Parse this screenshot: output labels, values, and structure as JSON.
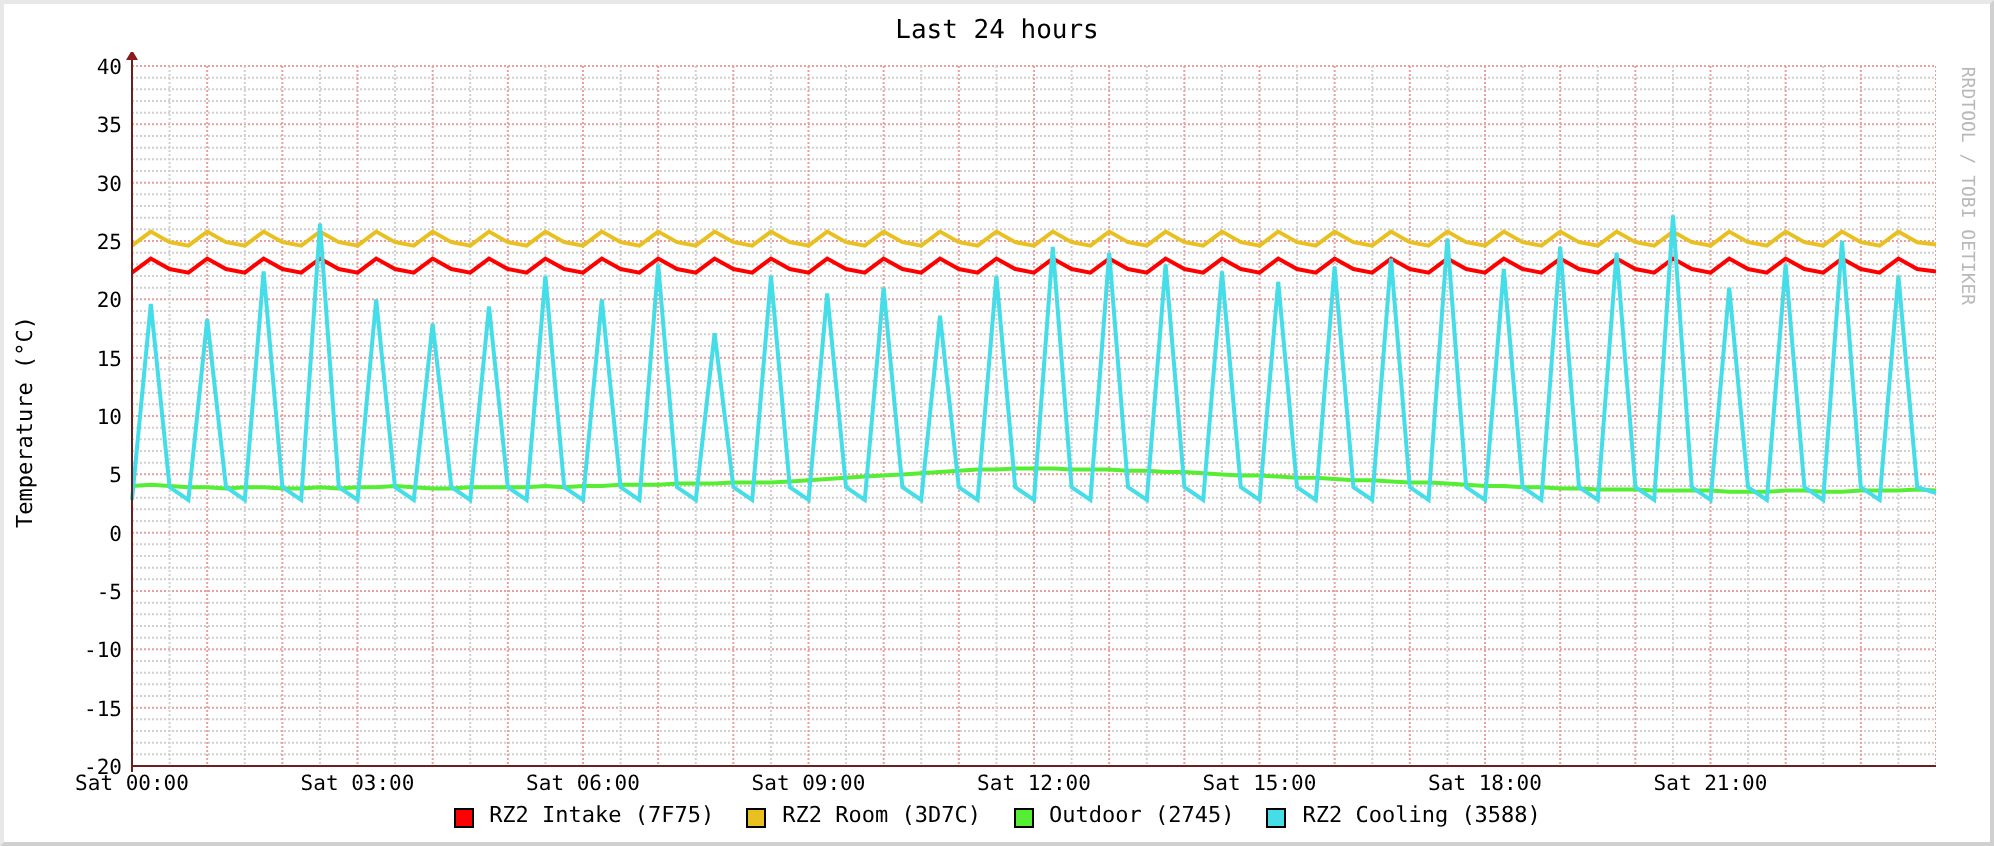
{
  "graph": {
    "side_label": "RRDTOOL / TOBI OETIKER",
    "chart_data": {
      "type": "line",
      "title": "Last 24 hours",
      "ylabel": "Temperature (°C)",
      "categories": [
        "Sat 00:00",
        null,
        null,
        null,
        null,
        null,
        null,
        null,
        null,
        null,
        null,
        null,
        "Sat 03:00",
        null,
        null,
        null,
        null,
        null,
        null,
        null,
        null,
        null,
        null,
        null,
        "Sat 06:00",
        null,
        null,
        null,
        null,
        null,
        null,
        null,
        null,
        null,
        null,
        null,
        "Sat 09:00",
        null,
        null,
        null,
        null,
        null,
        null,
        null,
        null,
        null,
        null,
        null,
        "Sat 12:00",
        null,
        null,
        null,
        null,
        null,
        null,
        null,
        null,
        null,
        null,
        null,
        "Sat 15:00",
        null,
        null,
        null,
        null,
        null,
        null,
        null,
        null,
        null,
        null,
        null,
        "Sat 18:00",
        null,
        null,
        null,
        null,
        null,
        null,
        null,
        null,
        null,
        null,
        null,
        "Sat 21:00",
        null,
        null,
        null,
        null,
        null,
        null,
        null,
        null,
        null,
        null,
        null,
        null
      ],
      "ylim": [
        -20,
        40
      ],
      "grid": true,
      "yticks": [
        -20,
        -15,
        -10,
        -5,
        0,
        5,
        10,
        15,
        20,
        25,
        30,
        35,
        40
      ],
      "series": [
        {
          "name": "RZ2 Intake (7F75)",
          "color": "#ff0000",
          "values": [
            22.3,
            23.5,
            22.6,
            22.3,
            23.5,
            22.6,
            22.3,
            23.5,
            22.6,
            22.3,
            23.5,
            22.6,
            22.3,
            23.5,
            22.6,
            22.3,
            23.5,
            22.6,
            22.3,
            23.5,
            22.6,
            22.3,
            23.5,
            22.6,
            22.3,
            23.5,
            22.6,
            22.3,
            23.5,
            22.6,
            22.3,
            23.5,
            22.6,
            22.3,
            23.5,
            22.6,
            22.3,
            23.5,
            22.6,
            22.3,
            23.5,
            22.6,
            22.3,
            23.5,
            22.6,
            22.3,
            23.5,
            22.6,
            22.3,
            23.5,
            22.6,
            22.3,
            23.5,
            22.6,
            22.3,
            23.5,
            22.6,
            22.3,
            23.5,
            22.6,
            22.3,
            23.5,
            22.6,
            22.3,
            23.5,
            22.6,
            22.3,
            23.5,
            22.6,
            22.3,
            23.5,
            22.6,
            22.3,
            23.5,
            22.6,
            22.3,
            23.5,
            22.6,
            22.3,
            23.5,
            22.6,
            22.3,
            23.5,
            22.6,
            22.3,
            23.5,
            22.6,
            22.3,
            23.5,
            22.6,
            22.3,
            23.5,
            22.6,
            22.3,
            23.5,
            22.6,
            22.4
          ]
        },
        {
          "name": "RZ2 Room (3D7C)",
          "color": "#e8c020",
          "values": [
            24.6,
            25.8,
            24.9,
            24.6,
            25.8,
            24.9,
            24.6,
            25.8,
            24.9,
            24.6,
            25.8,
            24.9,
            24.6,
            25.8,
            24.9,
            24.6,
            25.8,
            24.9,
            24.6,
            25.8,
            24.9,
            24.6,
            25.8,
            24.9,
            24.6,
            25.8,
            24.9,
            24.6,
            25.8,
            24.9,
            24.6,
            25.8,
            24.9,
            24.6,
            25.8,
            24.9,
            24.6,
            25.8,
            24.9,
            24.6,
            25.8,
            24.9,
            24.6,
            25.8,
            24.9,
            24.6,
            25.8,
            24.9,
            24.6,
            25.8,
            24.9,
            24.6,
            25.8,
            24.9,
            24.6,
            25.8,
            24.9,
            24.6,
            25.8,
            24.9,
            24.6,
            25.8,
            24.9,
            24.6,
            25.8,
            24.9,
            24.6,
            25.8,
            24.9,
            24.6,
            25.8,
            24.9,
            24.6,
            25.8,
            24.9,
            24.6,
            25.8,
            24.9,
            24.6,
            25.8,
            24.9,
            24.6,
            25.8,
            24.9,
            24.6,
            25.8,
            24.9,
            24.6,
            25.8,
            24.9,
            24.6,
            25.8,
            24.9,
            24.6,
            25.8,
            24.9,
            24.7
          ]
        },
        {
          "name": "Outdoor (2745)",
          "color": "#55ee33",
          "values": [
            4.0,
            4.1,
            4.0,
            3.9,
            3.9,
            3.8,
            3.9,
            3.9,
            3.8,
            3.8,
            3.9,
            3.8,
            3.9,
            3.9,
            4.0,
            3.9,
            3.8,
            3.8,
            3.9,
            3.9,
            3.9,
            3.9,
            4.0,
            3.9,
            4.0,
            4.0,
            4.1,
            4.1,
            4.1,
            4.2,
            4.2,
            4.2,
            4.3,
            4.3,
            4.3,
            4.4,
            4.5,
            4.6,
            4.7,
            4.8,
            4.9,
            5.0,
            5.1,
            5.2,
            5.3,
            5.4,
            5.4,
            5.5,
            5.5,
            5.5,
            5.4,
            5.4,
            5.4,
            5.3,
            5.3,
            5.2,
            5.2,
            5.1,
            5.0,
            4.9,
            4.9,
            4.8,
            4.7,
            4.7,
            4.6,
            4.5,
            4.5,
            4.4,
            4.3,
            4.3,
            4.2,
            4.1,
            4.0,
            4.0,
            3.9,
            3.9,
            3.8,
            3.8,
            3.7,
            3.7,
            3.7,
            3.6,
            3.6,
            3.6,
            3.6,
            3.5,
            3.5,
            3.5,
            3.6,
            3.6,
            3.5,
            3.5,
            3.6,
            3.6,
            3.6,
            3.7,
            3.6
          ]
        },
        {
          "name": "RZ2 Cooling (3588)",
          "color": "#44dde8",
          "values": [
            2.8,
            19.6,
            3.9,
            2.8,
            18.3,
            3.9,
            2.8,
            22.4,
            3.9,
            2.8,
            26.5,
            3.9,
            2.8,
            20.0,
            3.9,
            2.8,
            17.9,
            3.9,
            2.8,
            19.4,
            3.9,
            2.8,
            22.0,
            3.9,
            2.8,
            20.0,
            3.9,
            2.8,
            23.0,
            3.9,
            2.8,
            17.1,
            3.9,
            2.8,
            22.0,
            3.9,
            2.8,
            20.5,
            3.9,
            2.8,
            21.0,
            3.9,
            2.8,
            18.6,
            3.9,
            2.8,
            22.0,
            3.9,
            2.8,
            24.5,
            3.9,
            2.8,
            24.0,
            3.9,
            2.8,
            23.0,
            3.9,
            2.8,
            22.4,
            3.9,
            2.8,
            21.5,
            3.9,
            2.8,
            22.8,
            3.9,
            2.8,
            23.5,
            3.9,
            2.8,
            25.2,
            3.9,
            2.8,
            22.6,
            3.9,
            2.8,
            24.5,
            3.9,
            2.8,
            24.0,
            3.9,
            2.8,
            27.2,
            3.9,
            2.8,
            21.0,
            3.9,
            2.8,
            23.0,
            3.9,
            2.8,
            25.0,
            3.9,
            2.8,
            22.0,
            3.9,
            3.4
          ]
        }
      ]
    }
  }
}
